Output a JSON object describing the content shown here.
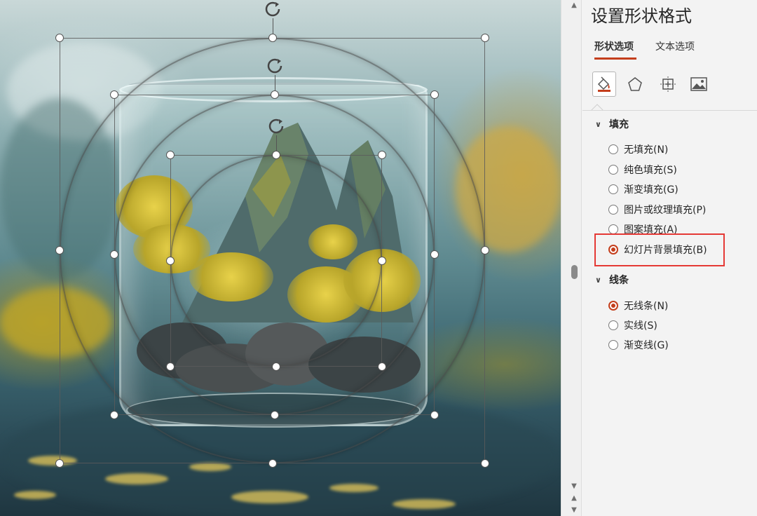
{
  "pane": {
    "title": "设置形状格式",
    "tabs": [
      {
        "label": "形状选项",
        "active": true
      },
      {
        "label": "文本选项",
        "active": false
      }
    ],
    "icons": [
      "fill-line-icon",
      "effects-pentagon-icon",
      "size-properties-icon",
      "picture-icon"
    ],
    "fill_section": {
      "title": "填充",
      "options": [
        {
          "label": "无填充(N)",
          "selected": false
        },
        {
          "label": "纯色填充(S)",
          "selected": false
        },
        {
          "label": "渐变填充(G)",
          "selected": false
        },
        {
          "label": "图片或纹理填充(P)",
          "selected": false
        },
        {
          "label": "图案填充(A)",
          "selected": false
        },
        {
          "label": "幻灯片背景填充(B)",
          "selected": true
        }
      ]
    },
    "line_section": {
      "title": "线条",
      "options": [
        {
          "label": "无线条(N)",
          "selected": false
        },
        {
          "label": "实线(S)",
          "selected": false
        },
        {
          "label": "渐变线(G)",
          "selected": false
        }
      ]
    }
  },
  "colors": {
    "accent": "#c43e1c",
    "highlight_box": "#e53935",
    "pane_background": "#f3f3f3"
  }
}
